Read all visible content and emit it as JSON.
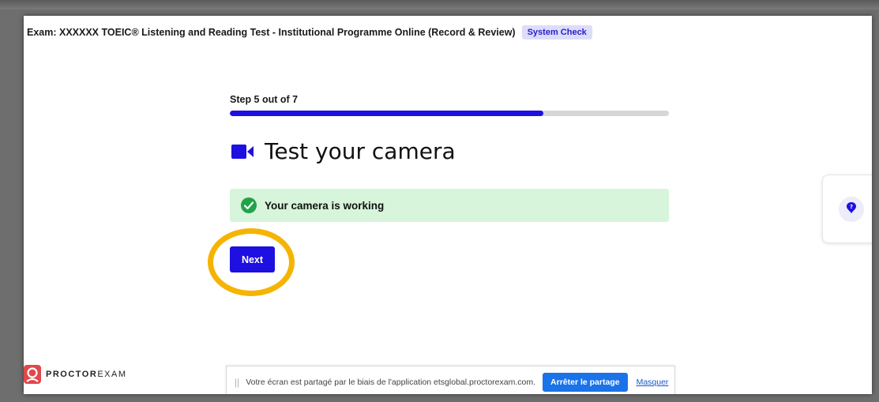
{
  "header": {
    "exam_title": "Exam: XXXXXX TOEIC® Listening and Reading Test - Institutional Programme Online (Record & Review)",
    "badge": "System Check"
  },
  "step": {
    "label": "Step 5 out of 7",
    "progress_fraction": 0.714
  },
  "main": {
    "title": "Test your camera",
    "title_icon": "video-camera-icon",
    "success_message": "Your camera is working",
    "success_icon": "check-circle-icon",
    "next_label": "Next"
  },
  "help": {
    "icon": "question-icon"
  },
  "logo": {
    "text_bold": "PROCTOR",
    "text_light": "EXAM"
  },
  "share_bar": {
    "message": "Votre écran est partagé par le biais de l'application etsglobal.proctorexam.com.",
    "stop_label": "Arrêter le partage",
    "hide_label": "Masquer"
  },
  "colors": {
    "accent": "#1e10e0",
    "success_bg": "#d6f5da",
    "success_icon": "#22a349",
    "highlight": "#f5b400",
    "share_button": "#1a73e8"
  }
}
